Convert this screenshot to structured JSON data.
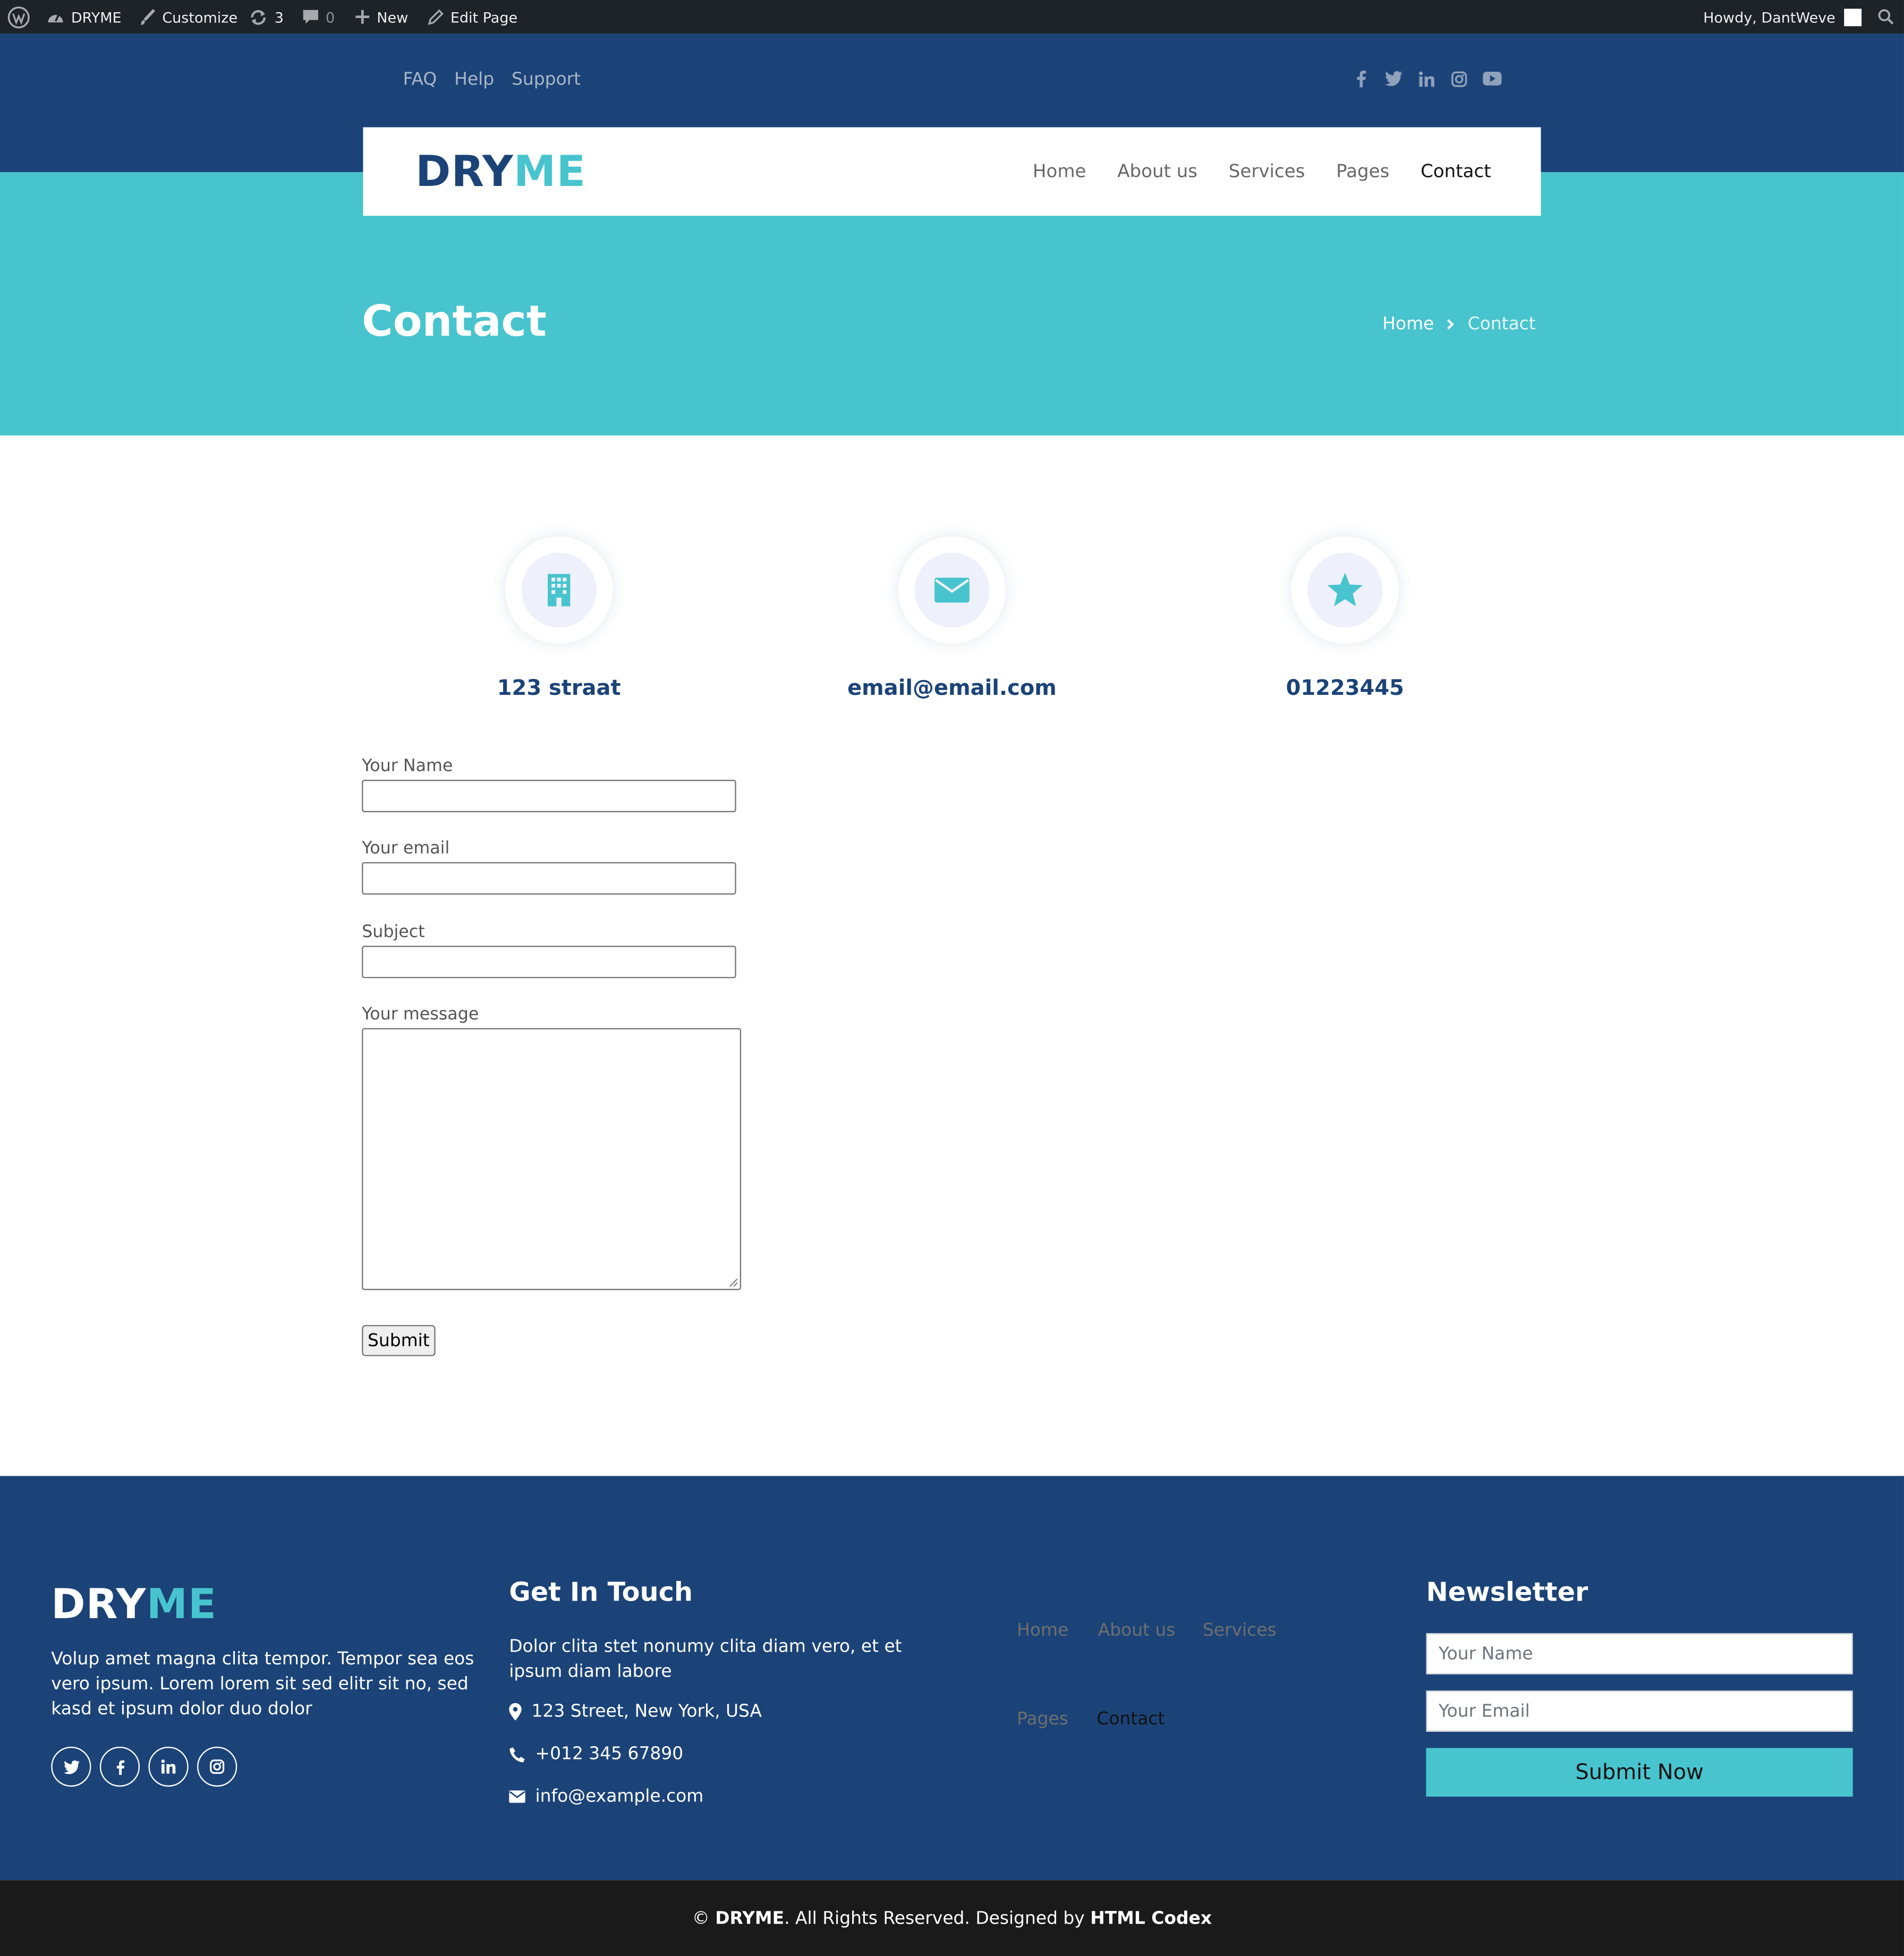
{
  "admin_bar": {
    "site_name": "DRYME",
    "customize": "Customize",
    "updates_count": "3",
    "comments_count": "0",
    "new_label": "New",
    "edit_page": "Edit Page",
    "howdy": "Howdy, DantWeve"
  },
  "topbar": {
    "links": [
      "FAQ",
      "Help",
      "Support"
    ],
    "social_icons": [
      "facebook-icon",
      "twitter-icon",
      "linkedin-icon",
      "instagram-icon",
      "youtube-icon"
    ]
  },
  "brand": {
    "part1": "DRY",
    "part2": "ME"
  },
  "nav": {
    "items": [
      "Home",
      "About us",
      "Services",
      "Pages",
      "Contact"
    ],
    "active": "Contact"
  },
  "hero": {
    "title": "Contact",
    "breadcrumb_home": "Home",
    "breadcrumb_current": "Contact"
  },
  "contact_cards": [
    {
      "icon": "building-icon",
      "text": "123 straat"
    },
    {
      "icon": "envelope-icon",
      "text": "email@email.com"
    },
    {
      "icon": "star-icon",
      "text": "01223445"
    }
  ],
  "form": {
    "name_label": "Your Name",
    "email_label": "Your email",
    "subject_label": "Subject",
    "message_label": "Your message",
    "submit_label": "Submit"
  },
  "footer": {
    "description": "Volup amet magna clita tempor. Tempor sea eos vero ipsum. Lorem lorem sit sed elitr sit no, sed kasd et ipsum dolor duo dolor",
    "social_icons": [
      "twitter-icon",
      "facebook-icon",
      "linkedin-icon",
      "instagram-icon"
    ],
    "get_in_touch": {
      "title": "Get In Touch",
      "description": "Dolor clita stet nonumy clita diam vero, et et ipsum diam labore",
      "address": "123 Street, New York, USA",
      "phone": "+012 345 67890",
      "email": "info@example.com"
    },
    "links": [
      "Home",
      "About us",
      "Services",
      "Pages",
      "Contact"
    ],
    "newsletter": {
      "title": "Newsletter",
      "name_placeholder": "Your Name",
      "email_placeholder": "Your Email",
      "button": "Submit Now"
    }
  },
  "copyright": {
    "prefix": "©",
    "brand": "DRYME",
    "middle": ". All Rights Reserved. Designed by",
    "designer": "HTML Codex"
  },
  "colors": {
    "navy": "#1b4378",
    "teal": "#47c4ce",
    "admin_bar": "#1d2327",
    "copyright_bar": "#1a1a1a"
  }
}
